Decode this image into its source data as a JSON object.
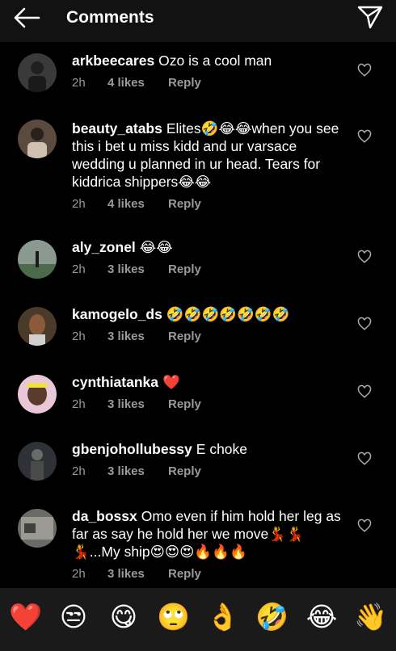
{
  "header": {
    "title": "Comments",
    "back_icon": "arrow-left-icon",
    "send_icon": "paper-plane-icon"
  },
  "comments": [
    {
      "username": "arkbeecares",
      "text": "Ozo is a cool man",
      "time": "2h",
      "likes": "4 likes",
      "reply": "Reply",
      "avatar_color": "#3a3a3a"
    },
    {
      "username": "beauty_atabs",
      "text": "Elites🤣😂😂when you see this i bet u miss kidd and ur varsace wedding u planned in ur head. Tears for kiddrica shippers😂😂",
      "time": "2h",
      "likes": "4 likes",
      "reply": "Reply",
      "avatar_color": "#5a4a40"
    },
    {
      "username": "aly_zonel",
      "text": "😂😂",
      "time": "2h",
      "likes": "3 likes",
      "reply": "Reply",
      "avatar_color": "#8a9a90"
    },
    {
      "username": "kamogelo_ds",
      "text": "🤣🤣🤣🤣🤣🤣🤣",
      "time": "2h",
      "likes": "3 likes",
      "reply": "Reply",
      "avatar_color": "#4a3a2a"
    },
    {
      "username": "cynthiatanka",
      "text": "❤️",
      "time": "2h",
      "likes": "3 likes",
      "reply": "Reply",
      "avatar_color": "#e8c8d8"
    },
    {
      "username": "gbenjohollubessy",
      "text": "E choke",
      "time": "2h",
      "likes": "3 likes",
      "reply": "Reply",
      "avatar_color": "#2e3236"
    },
    {
      "username": "da_bossx",
      "text": "Omo  even if him hold her leg as far as say he hold her we move💃💃💃...My ship😍😍😍🔥🔥🔥",
      "time": "2h",
      "likes": "3 likes",
      "reply": "Reply",
      "avatar_color": "#6a6a66"
    }
  ],
  "emoji_bar": [
    "❤️",
    "😒",
    "😋",
    "🙄",
    "👌",
    "🤣",
    "😂",
    "👋"
  ],
  "colors": {
    "background": "#000000",
    "header": "#121212",
    "meta_text": "#9a9a9a",
    "emoji_bar": "#1a1a1a"
  }
}
